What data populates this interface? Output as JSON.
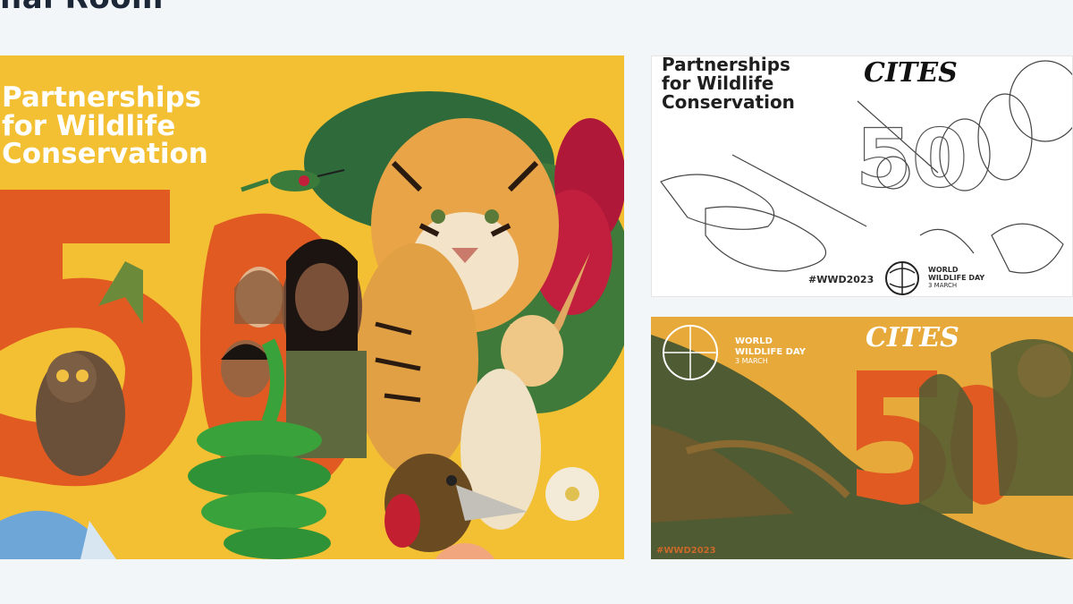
{
  "page": {
    "heading": "nal Room"
  },
  "main_poster": {
    "title_line1": "Partnerships",
    "title_line2": "for Wildlife",
    "title_line3": "Conservation",
    "number": "50"
  },
  "coloring_poster": {
    "title_line1": "Partnerships",
    "title_line2": "for Wildlife",
    "title_line3": "Conservation",
    "cites_logo": "CITES",
    "hashtag": "#WWD2023",
    "wwd_line1": "WORLD",
    "wwd_line2": "WILDLIFE DAY",
    "wwd_date": "3 MARCH"
  },
  "banner_poster": {
    "wwd_line1": "WORLD",
    "wwd_line2": "WILDLIFE DAY",
    "wwd_date": "3 MARCH",
    "cites_logo": "CITES",
    "hashtag": "#WWD2023"
  },
  "colors": {
    "main_background": "#f3bf33",
    "accent_orange": "#e05a22",
    "banner_background": "#e6a93a",
    "banner_dark": "#4f5b32",
    "page_background": "#f3f6f9"
  },
  "icons": [
    "tiger-icon",
    "fox-icon",
    "snake-icon",
    "hummingbird-icon",
    "globe-icon"
  ]
}
